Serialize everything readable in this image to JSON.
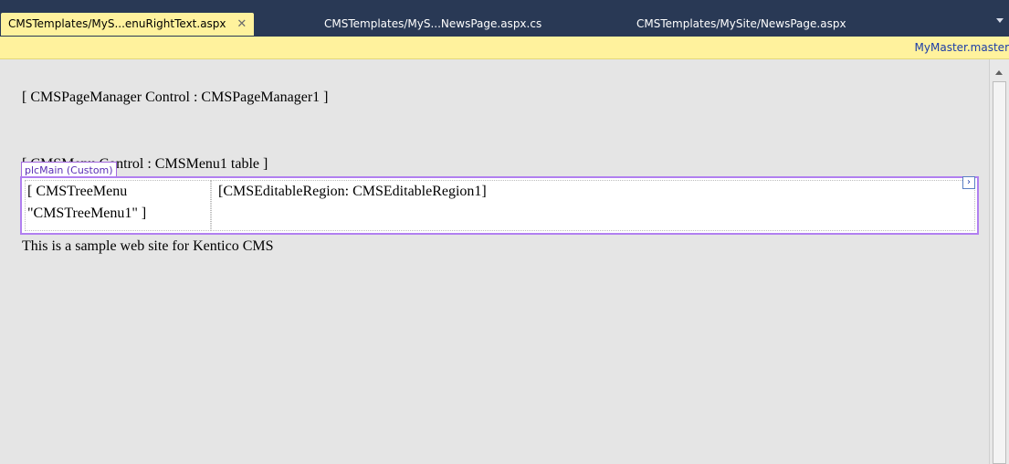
{
  "tabs": [
    {
      "label": "CMSTemplates/MyS...enuRightText.aspx",
      "close": "✕",
      "active": true
    },
    {
      "label": "CMSTemplates/MyS...NewsPage.aspx.cs",
      "active": false
    },
    {
      "label": "CMSTemplates/MySite/NewsPage.aspx",
      "active": false
    }
  ],
  "master_page": {
    "link": "MyMaster.master"
  },
  "design": {
    "page_manager": "[ CMSPageManager Control : CMSPageManager1 ]",
    "menu_control": "[ CMSMenu Control : CMSMenu1  table ]",
    "placeholder_tag": "plcMain (Custom)",
    "tree_menu": "[ CMSTreeMenu \"CMSTreeMenu1\" ]",
    "editable_region": "[CMSEditableRegion: CMSEditableRegion1]",
    "smart_tag": "›",
    "footer_text": "This is a sample web site for Kentico CMS"
  },
  "colors": {
    "tabstrip_bg": "#293955",
    "active_tab_bg": "#fff29d",
    "design_bg": "#e5e5e5",
    "placeholder_border": "#b17ff0",
    "link": "#1b3ca8"
  }
}
